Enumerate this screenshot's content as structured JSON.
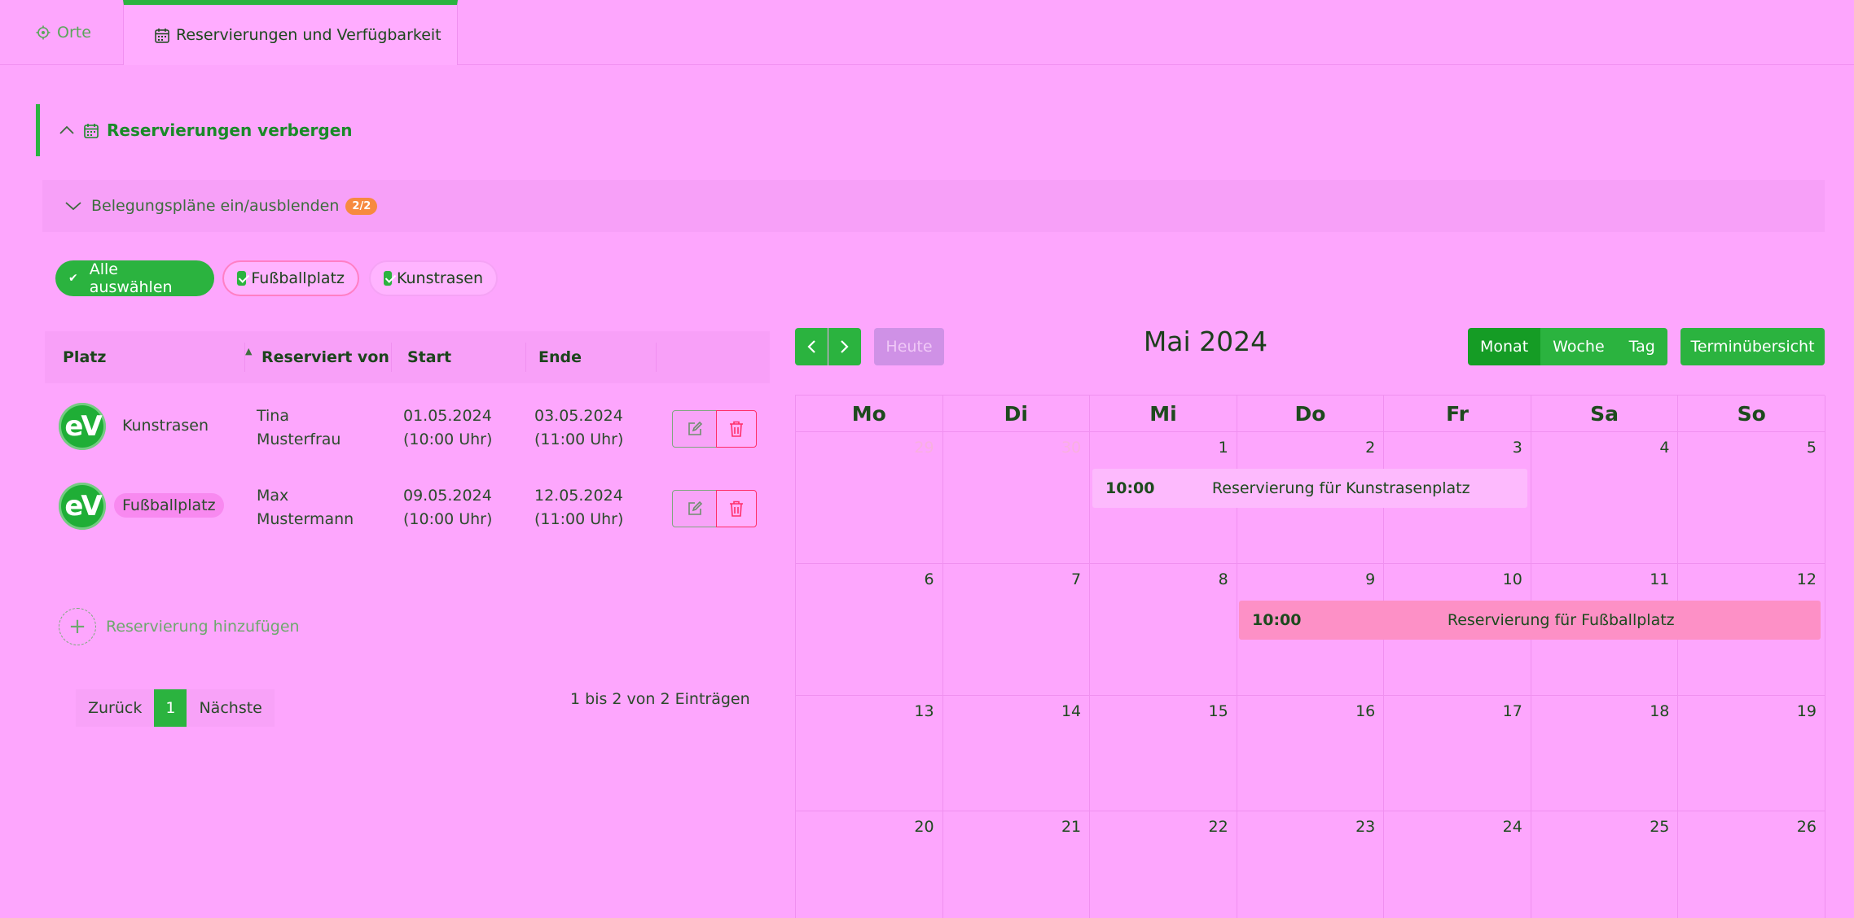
{
  "tabs": [
    {
      "label": "Orte"
    },
    {
      "label": "Reservierungen und Verfügbarkeit"
    }
  ],
  "reservations_toggle": {
    "label": "Reservierungen verbergen"
  },
  "plans_toggle": {
    "label": "Belegungspläne ein/ausblenden",
    "badge": "2/2"
  },
  "filters": {
    "select_all": "Alle auswählen",
    "items": [
      {
        "label": "Fußballplatz",
        "checked": true
      },
      {
        "label": "Kunstrasen",
        "checked": true
      }
    ]
  },
  "table": {
    "headers": {
      "platz": "Platz",
      "reserviert_von": "Reserviert von",
      "start": "Start",
      "ende": "Ende"
    },
    "rows": [
      {
        "logo": "eV",
        "platz": "Kunstrasen",
        "name1": "Tina",
        "name2": "Musterfrau",
        "start_date": "01.05.2024",
        "start_time": "(10:00 Uhr)",
        "end_date": "03.05.2024",
        "end_time": "(11:00 Uhr)"
      },
      {
        "logo": "eV",
        "platz": "Fußballplatz",
        "name1": "Max",
        "name2": "Mustermann",
        "start_date": "09.05.2024",
        "start_time": "(10:00 Uhr)",
        "end_date": "12.05.2024",
        "end_time": "(11:00 Uhr)"
      }
    ],
    "add_label": "Reservierung hinzufügen",
    "pagination": {
      "prev": "Zurück",
      "page": "1",
      "next": "Nächste"
    },
    "info": "1 bis 2 von 2 Einträgen"
  },
  "calendar": {
    "today": "Heute",
    "title": "Mai 2024",
    "views": [
      "Monat",
      "Woche",
      "Tag"
    ],
    "active_view": "Monat",
    "overview": "Terminübersicht",
    "weekdays": [
      "Mo",
      "Di",
      "Mi",
      "Do",
      "Fr",
      "Sa",
      "So"
    ],
    "weeks": [
      [
        {
          "d": "29",
          "other": true
        },
        {
          "d": "30",
          "other": true
        },
        {
          "d": "1"
        },
        {
          "d": "2"
        },
        {
          "d": "3"
        },
        {
          "d": "4"
        },
        {
          "d": "5"
        }
      ],
      [
        {
          "d": "6"
        },
        {
          "d": "7"
        },
        {
          "d": "8"
        },
        {
          "d": "9"
        },
        {
          "d": "10"
        },
        {
          "d": "11"
        },
        {
          "d": "12"
        }
      ],
      [
        {
          "d": "13"
        },
        {
          "d": "14"
        },
        {
          "d": "15"
        },
        {
          "d": "16"
        },
        {
          "d": "17"
        },
        {
          "d": "18"
        },
        {
          "d": "19"
        }
      ],
      [
        {
          "d": "20"
        },
        {
          "d": "21"
        },
        {
          "d": "22"
        },
        {
          "d": "23"
        },
        {
          "d": "24"
        },
        {
          "d": "25"
        },
        {
          "d": "26"
        }
      ]
    ],
    "events": [
      {
        "time": "10:00",
        "title": "Reservierung für Kunstrasenplatz"
      },
      {
        "time": "10:00",
        "title": "Reservierung für Fußballplatz"
      }
    ]
  },
  "colors": {
    "accent": "#2bb33f",
    "background": "#fda6fd",
    "danger": "#ff2e68",
    "badge": "#f78a3f"
  }
}
